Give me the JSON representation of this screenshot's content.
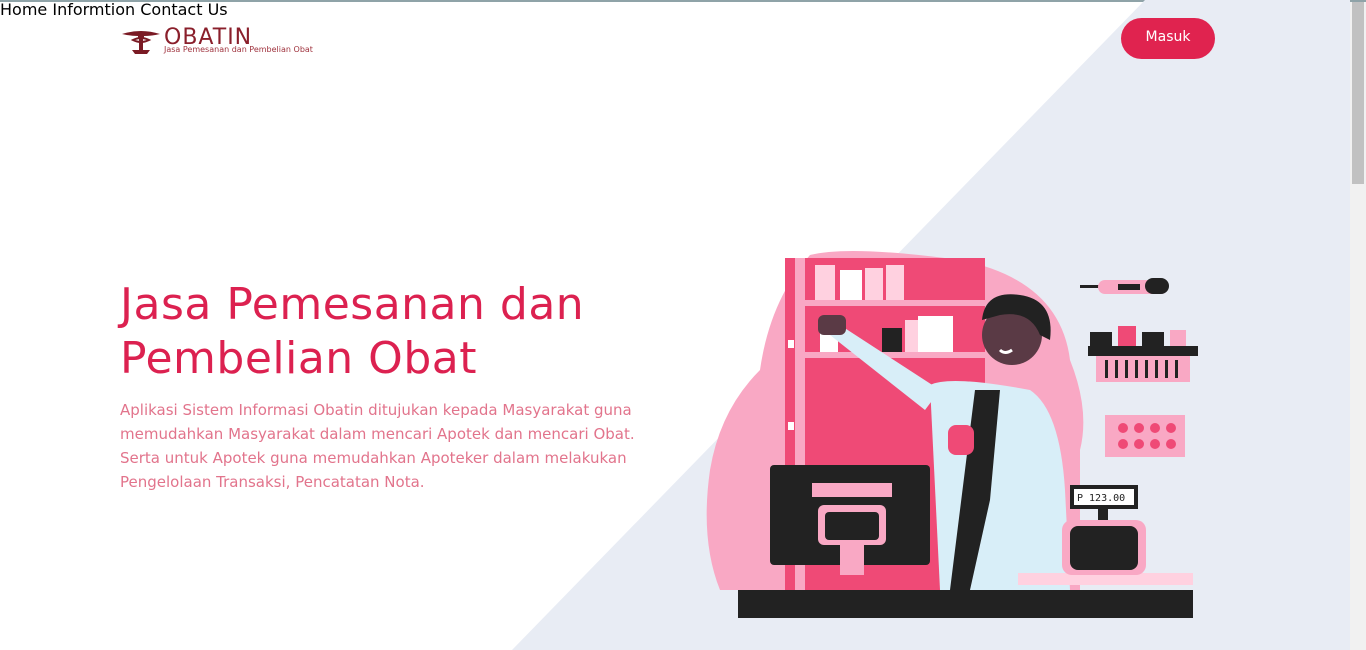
{
  "header": {
    "logo_text": "OBATIN",
    "logo_subtitle": "Jasa Pemesanan dan Pembelian Obat",
    "nav": [
      {
        "label": "Home"
      },
      {
        "label": "Informtion"
      },
      {
        "label": "Contact Us"
      }
    ],
    "login_label": "Masuk"
  },
  "hero": {
    "title": "Jasa Pemesanan dan Pembelian Obat",
    "description": "Aplikasi Sistem Informasi Obatin ditujukan kepada Masyarakat guna memudahkan Masyarakat dalam mencari Apotek dan mencari Obat. Serta untuk Apotek guna memudahkan Apoteker dalam melakukan Pengelolaan Transaksi, Pencatatan Nota."
  },
  "illustration": {
    "register_display": "P 123.00"
  },
  "colors": {
    "accent": "#e0234f",
    "title": "#dc2150",
    "text": "#e2748c",
    "logo": "#8a1f2b",
    "diagonal_bg": "#e8ecf4"
  },
  "icons": [
    "pharmacy-logo-icon"
  ]
}
